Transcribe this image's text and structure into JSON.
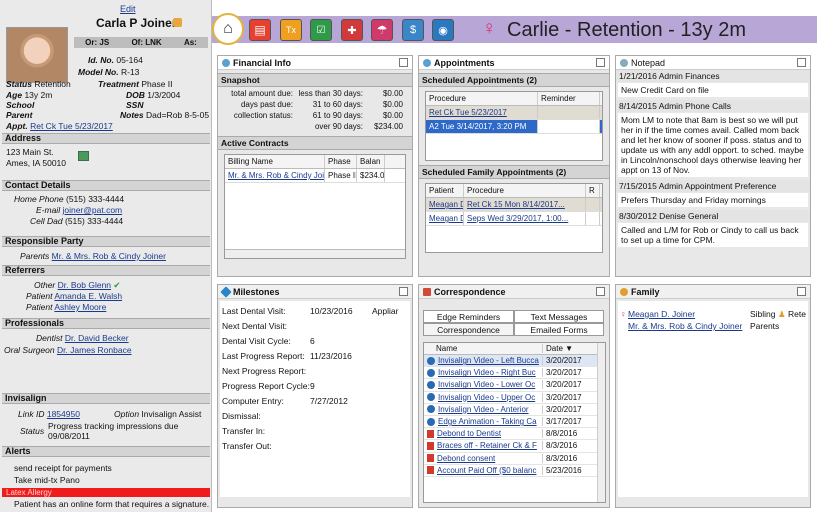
{
  "patient": {
    "edit": "Edit",
    "name": "Carla P Joiner",
    "or": "Or: JS",
    "of": "Of: LNK",
    "as": "As:",
    "id_label": "Id. No.",
    "id": "05-164",
    "model_label": "Model No.",
    "model": "R-13",
    "status_label": "Status",
    "status": "Retention",
    "treatment_label": "Treatment",
    "treatment": "Phase II",
    "age_label": "Age",
    "age": "13y 2m",
    "dob_label": "DOB",
    "dob": "1/3/2004",
    "school_label": "School",
    "ssn_label": "SSN",
    "parent_label": "Parent",
    "notes_label": "Notes",
    "notes": "Dad=Rob 8-5-05",
    "appt_label": "Appt.",
    "appt": "Ret Ck  Tue 5/23/2017"
  },
  "sections": {
    "address": "Address",
    "contact": "Contact Details",
    "responsible": "Responsible Party",
    "referrers": "Referrers",
    "professionals": "Professionals",
    "invisalign": "Invisalign",
    "alerts": "Alerts"
  },
  "address": [
    "123 Main St.",
    "Ames, IA 50010"
  ],
  "contact": [
    {
      "label": "Home Phone",
      "value": "(515) 333-4444"
    },
    {
      "label": "E-mail",
      "value": "joiner@pat.com"
    },
    {
      "label": "Cell Dad",
      "value": "(515) 333-4444"
    }
  ],
  "responsible": {
    "label": "Parents",
    "value": "Mr. & Mrs. Rob & Cindy Joiner"
  },
  "referrers": [
    {
      "label": "Other",
      "value": "Dr. Bob Glenn"
    },
    {
      "label": "Patient",
      "value": "Amanda E. Walsh"
    },
    {
      "label": "Patient",
      "value": "Ashley Moore"
    }
  ],
  "professionals": [
    {
      "label": "Dentist",
      "value": "Dr. David Becker"
    },
    {
      "label": "Oral Surgeon",
      "value": "Dr. James Ronbace"
    }
  ],
  "invisalign": {
    "link_label": "Link ID",
    "link": "1854950",
    "option_label": "Option",
    "option": "Invisalign Assist",
    "status_label": "Status",
    "status1": "Progress tracking impressions due",
    "status2": "09/08/2011"
  },
  "alerts": [
    "send receipt for payments",
    "Take mid-tx Pano",
    "Latex Allergy",
    "Patient has an online form that requires a signature."
  ],
  "header": {
    "title": "Carlie - Retention - 13y 2m",
    "female_symbol": "♀"
  },
  "toolbar": {
    "icons": [
      "home-icon",
      "document-icon",
      "tx-icon",
      "check-card-icon",
      "pills-icon",
      "umbrella-icon",
      "dollar-icon",
      "camera-icon"
    ],
    "colors": [
      "#e8402f",
      "#f0a020",
      "#2e9a4a",
      "#d03a3a",
      "#d03a6a",
      "#3a86c8",
      "#2a78c0"
    ]
  },
  "financial": {
    "title": "Financial Info",
    "snapshot": "Snapshot",
    "rows": [
      {
        "label": "total amount due:",
        "range": "less than 30 days:",
        "amt": "$0.00"
      },
      {
        "label": "days past due:",
        "range": "31 to 60 days:",
        "amt": "$0.00"
      },
      {
        "label": "collection status:",
        "range": "61 to 90 days:",
        "amt": "$0.00"
      },
      {
        "label": "",
        "range": "over 90 days:",
        "amt": "$234.00"
      }
    ],
    "contracts": "Active Contracts",
    "cols": [
      "Billing Name",
      "Phase",
      "Balan"
    ],
    "contract_row": [
      "Mr. & Mrs. Rob & Cindy Joiner",
      "Phase II",
      "$234.0"
    ]
  },
  "appointments": {
    "title": "Appointments",
    "scheduled": "Scheduled Appointments (2)",
    "cols": [
      "Procedure",
      "Reminder"
    ],
    "rows": [
      "Ret Ck   Tue 5/23/2017",
      "A2   Tue 3/14/2017, 3:20 PM"
    ],
    "family": "Scheduled Family Appointments (2)",
    "fcols": [
      "Patient",
      "Procedure",
      "R"
    ],
    "frows": [
      [
        "Meagan D.",
        "Ret Ck 15   Mon 8/14/2017..."
      ],
      [
        "Meagan D.",
        "Seps   Wed 3/29/2017, 1:00..."
      ]
    ]
  },
  "notepad": {
    "title": "Notepad",
    "notes": [
      {
        "hdr": "1/21/2016  Admin  Finances",
        "body": "New Credit Card on file"
      },
      {
        "hdr": "8/14/2015  Admin  Phone Calls",
        "body": "Mom LM to note that 8am is best so we will put her in if the time comes avail.  Called mom back and let her know of sooner if poss. status and to update us with any addl opport. to sched. maybe in Lincoln/nonschool days otherwise leaving her appt on 13 of Nov."
      },
      {
        "hdr": "7/15/2015  Admin  Appointment Preference",
        "body": "Prefers Thursday and Friday mornings"
      },
      {
        "hdr": "8/30/2012  Denise  General",
        "body": "Called and L/M for Rob or Cindy to call us back to set up a time for CPM."
      }
    ]
  },
  "milestones": {
    "title": "Milestones",
    "rows": [
      {
        "label": "Last Dental Visit:",
        "value": "10/23/2016",
        "extra": "Appliar"
      },
      {
        "label": "Next Dental Visit:",
        "value": "",
        "extra": ""
      },
      {
        "label": "Dental Visit Cycle:",
        "value": "6",
        "extra": ""
      },
      {
        "label": "Last Progress Report:",
        "value": "11/23/2016",
        "extra": ""
      },
      {
        "label": "Next Progress Report:",
        "value": "",
        "extra": ""
      },
      {
        "label": "Progress Report Cycle:",
        "value": "9",
        "extra": ""
      },
      {
        "label": "Computer Entry:",
        "value": "7/27/2012",
        "extra": ""
      },
      {
        "label": "Dismissal:",
        "value": "",
        "extra": ""
      },
      {
        "label": "Transfer In:",
        "value": "",
        "extra": ""
      },
      {
        "label": "Transfer Out:",
        "value": "",
        "extra": ""
      }
    ]
  },
  "correspondence": {
    "title": "Correspondence",
    "tabs": [
      "Edge Reminders",
      "Text Messages",
      "Correspondence",
      "Emailed Forms"
    ],
    "cols": [
      "Name",
      "Date ▼"
    ],
    "rows": [
      [
        "Invisalign Video - Left Bucca",
        "3/20/2017"
      ],
      [
        "Invisalign Video - Right Buc",
        "3/20/2017"
      ],
      [
        "Invisalign Video - Lower Oc",
        "3/20/2017"
      ],
      [
        "Invisalign Video - Upper Oc",
        "3/20/2017"
      ],
      [
        "Invisalign Video - Anterior",
        "3/20/2017"
      ],
      [
        "Edge Animation - Taking Ca",
        "3/17/2017"
      ],
      [
        "Debond to Dentist",
        "8/8/2016"
      ],
      [
        "Braces off - Retainer Ck & F",
        "8/3/2016"
      ],
      [
        "Debond consent",
        "8/3/2016"
      ],
      [
        "Account Paid Off ($0 balanc",
        "5/23/2016"
      ]
    ]
  },
  "family": {
    "title": "Family",
    "rows": [
      {
        "name": "Meagan D. Joiner",
        "rel": "Sibling",
        "extra": "Rete"
      },
      {
        "name": "Mr. & Mrs. Rob & Cindy Joiner",
        "rel": "Parents",
        "extra": ""
      }
    ]
  }
}
